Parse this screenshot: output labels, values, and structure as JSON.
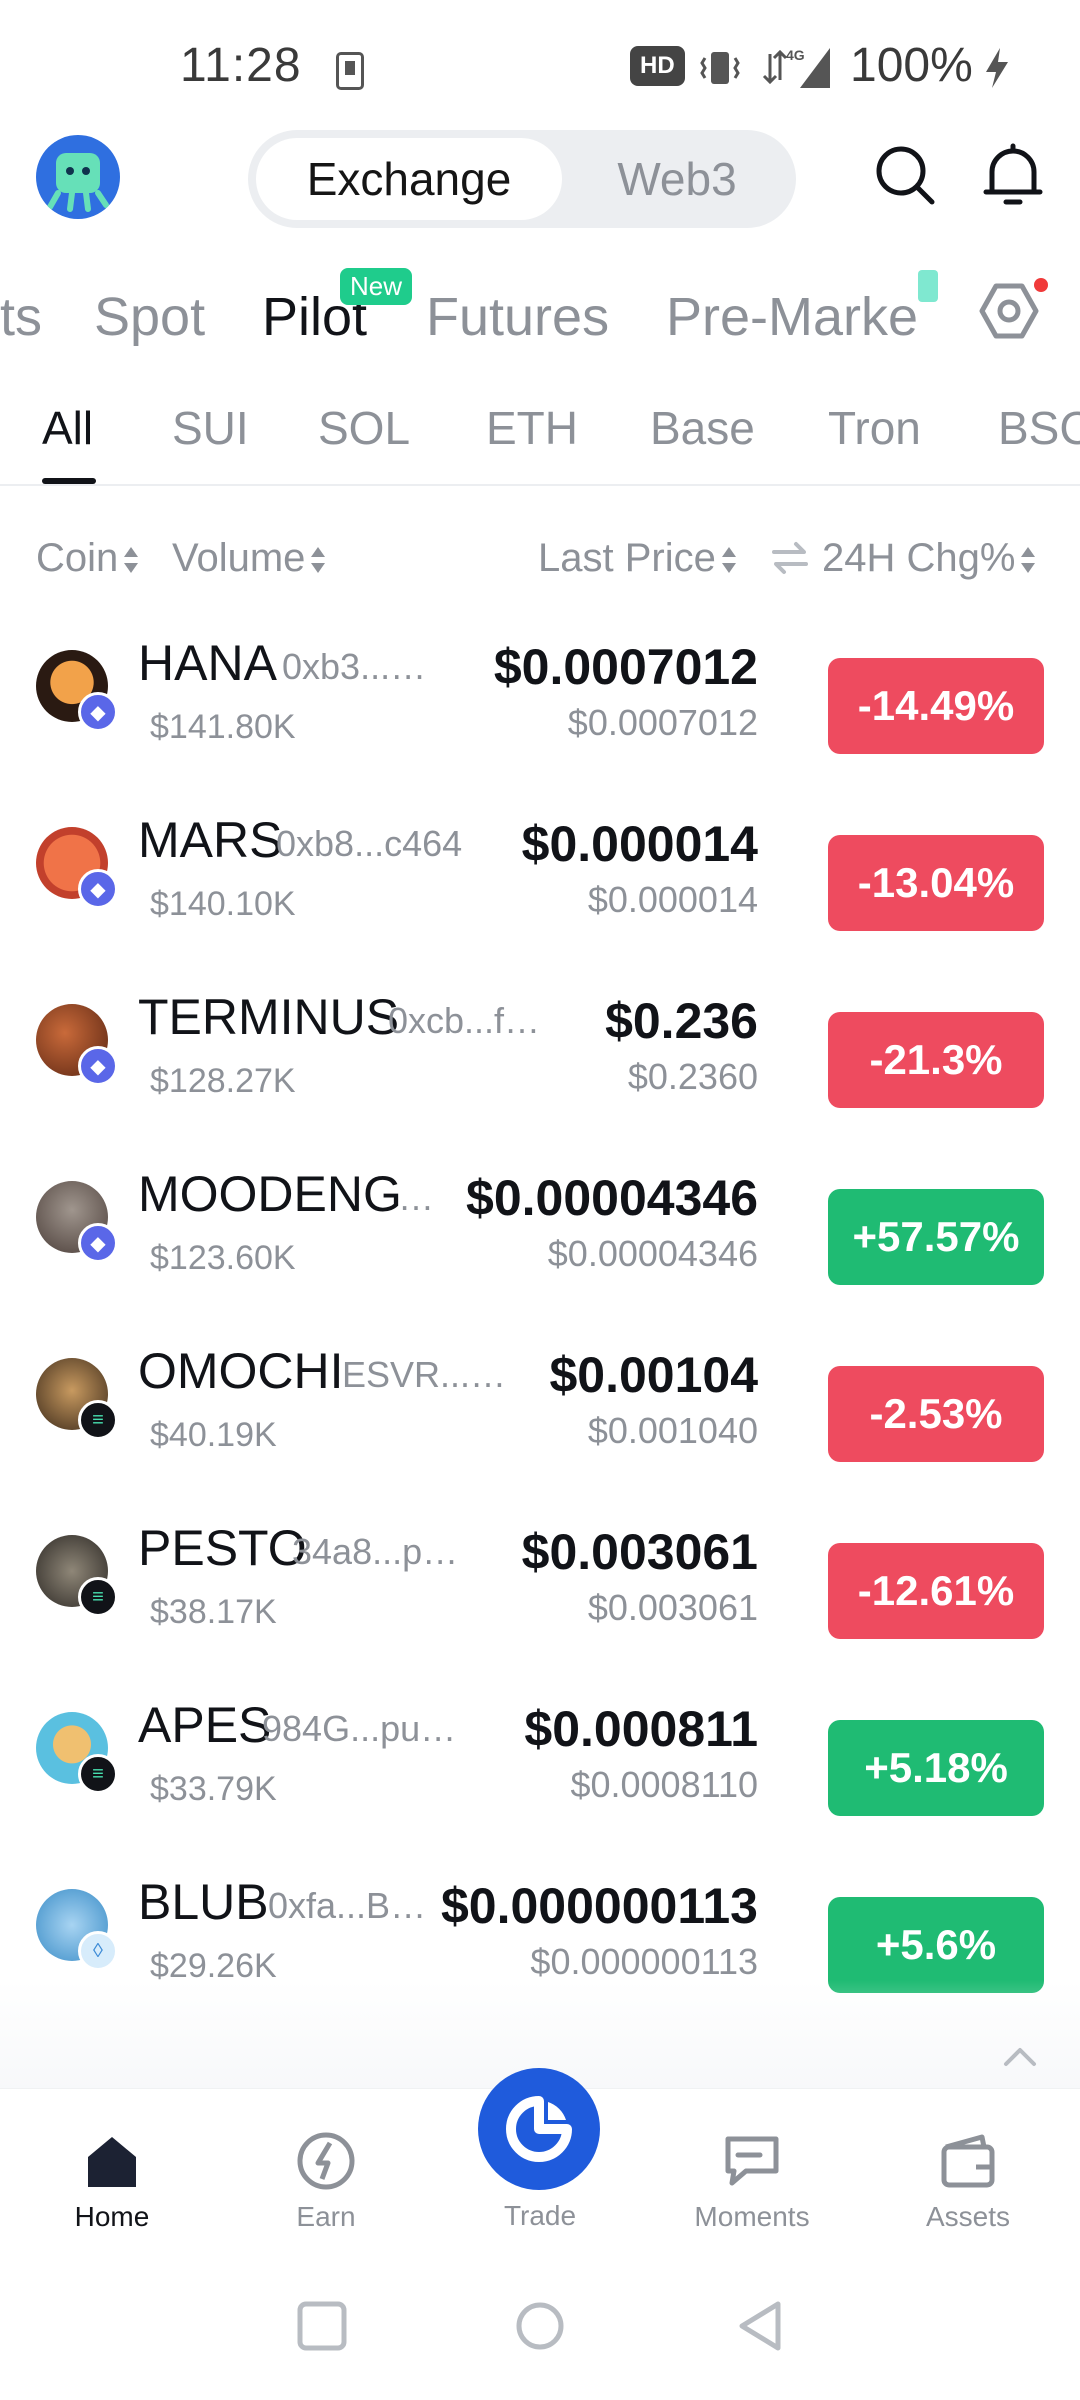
{
  "status_bar": {
    "time": "11:28",
    "network_badge": "HD",
    "signal_label": "4G",
    "battery": "100%"
  },
  "header": {
    "toggle": {
      "exchange": "Exchange",
      "web3": "Web3"
    }
  },
  "main_tabs": [
    {
      "label": "ts"
    },
    {
      "label": "Spot"
    },
    {
      "label": "Pilot",
      "badge": "New"
    },
    {
      "label": "Futures"
    },
    {
      "label": "Pre-Marke"
    }
  ],
  "chain_tabs": [
    {
      "label": "All"
    },
    {
      "label": "SUI"
    },
    {
      "label": "SOL"
    },
    {
      "label": "ETH"
    },
    {
      "label": "Base"
    },
    {
      "label": "Tron"
    },
    {
      "label": "BSC"
    }
  ],
  "columns": {
    "coin": "Coin",
    "volume": "Volume",
    "last_price": "Last Price",
    "change": "24H Chg%"
  },
  "rows": [
    {
      "name": "HANA",
      "addr": "0xb3...…",
      "volume": "$141.80K",
      "price": "$0.0007012",
      "subprice": "$0.0007012",
      "change": "-14.49%",
      "dir": "neg",
      "chain": "eth"
    },
    {
      "name": "MARS",
      "addr": "0xb8...c464",
      "volume": "$140.10K",
      "price": "$0.000014",
      "subprice": "$0.000014",
      "change": "-13.04%",
      "dir": "neg",
      "chain": "eth"
    },
    {
      "name": "TERMINUS",
      "addr": "0xcb...f…",
      "volume": "$128.27K",
      "price": "$0.236",
      "subprice": "$0.2360",
      "change": "-21.3%",
      "dir": "neg",
      "chain": "eth"
    },
    {
      "name": "MOODENG",
      "addr": "…",
      "volume": "$123.60K",
      "price": "$0.00004346",
      "subprice": "$0.00004346",
      "change": "+57.57%",
      "dir": "pos",
      "chain": "eth"
    },
    {
      "name": "OMOCHI",
      "addr": "ESVR...…",
      "volume": "$40.19K",
      "price": "$0.00104",
      "subprice": "$0.001040",
      "change": "-2.53%",
      "dir": "neg",
      "chain": "sol"
    },
    {
      "name": "PESTO",
      "addr": "34a8...p…",
      "volume": "$38.17K",
      "price": "$0.003061",
      "subprice": "$0.003061",
      "change": "-12.61%",
      "dir": "neg",
      "chain": "sol"
    },
    {
      "name": "APES",
      "addr": "984G...pu…",
      "volume": "$33.79K",
      "price": "$0.000811",
      "subprice": "$0.0008110",
      "change": "+5.18%",
      "dir": "pos",
      "chain": "sol"
    },
    {
      "name": "BLUB",
      "addr": "0xfa...B…",
      "volume": "$29.26K",
      "price": "$0.000000113",
      "subprice": "$0.000000113",
      "change": "+5.6%",
      "dir": "pos",
      "chain": "sui"
    }
  ],
  "bottom_nav": [
    {
      "label": "Home"
    },
    {
      "label": "Earn"
    },
    {
      "label": "Trade"
    },
    {
      "label": "Moments"
    },
    {
      "label": "Assets"
    }
  ],
  "colors": {
    "negative": "#ee4b5f",
    "positive": "#1fbb73",
    "accent": "#1f5bdc",
    "new_badge": "#1fcc8c"
  }
}
